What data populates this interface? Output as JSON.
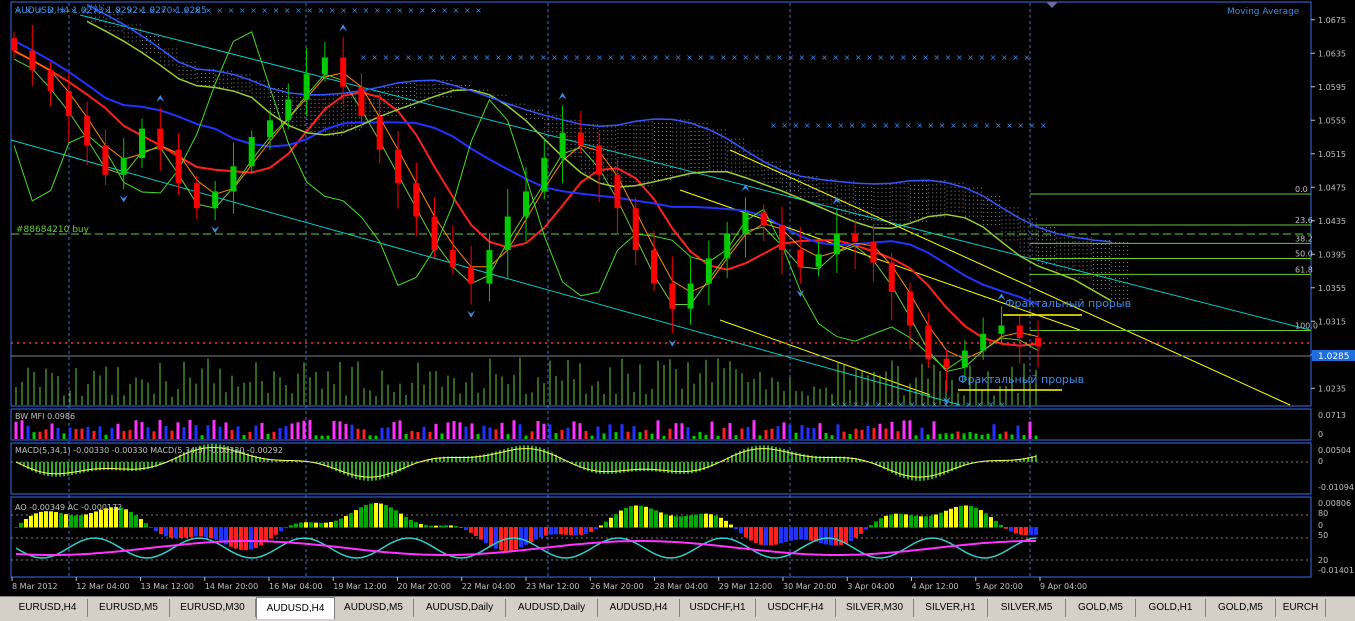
{
  "colors": {
    "background": "#000000",
    "frame": "#3a6ee8",
    "axis_text": "#c0c0c0",
    "bull_candle": "#00cc00",
    "bear_candle": "#ff0000",
    "price_label_bg": "#1e6ee0",
    "title_text": "#3a8ce8",
    "fractal_arrow": "#3a8ce8",
    "ichimoku_cloud_dots": "#ffffff",
    "channel": "#00cccc",
    "yellow_lines": "#ffff00",
    "fibo": "#66cc33",
    "macd_signal": "#ffff66",
    "ao_magenta": "#ff33ff",
    "ac_cyan": "#33cccc"
  },
  "main_chart": {
    "title": "AUDUSD,H4  1.0273 1.0292 1.0270 1.0285",
    "indicator_name": "Moving Average",
    "order_label": "#88684210 buy",
    "current_price": "1.0285",
    "annotations": [
      "Фрактальный прорыв",
      "Фрактальный прорыв"
    ],
    "price_ticks": [
      "1.0675",
      "1.0635",
      "1.0595",
      "1.0555",
      "1.0515",
      "1.0475",
      "1.0435",
      "1.0395",
      "1.0355",
      "1.0315",
      "1.0275",
      "1.0235"
    ],
    "price_range": [
      1.0215,
      1.0695
    ],
    "fibo_levels": [
      {
        "label": "0.0",
        "price": 1.0467
      },
      {
        "label": "23.6",
        "price": 1.043
      },
      {
        "label": "38.2",
        "price": 1.0408
      },
      {
        "label": "50.0",
        "price": 1.039
      },
      {
        "label": "61.8",
        "price": 1.0371
      },
      {
        "label": "100.0",
        "price": 1.0304
      }
    ],
    "closes": [
      1.0638,
      1.0615,
      1.059,
      1.056,
      1.0525,
      1.049,
      1.051,
      1.0545,
      1.052,
      1.048,
      1.045,
      1.047,
      1.05,
      1.0535,
      1.0555,
      1.058,
      1.061,
      1.063,
      1.0595,
      1.056,
      1.052,
      1.048,
      1.044,
      1.04,
      1.038,
      1.036,
      1.04,
      1.044,
      1.047,
      1.051,
      1.054,
      1.0525,
      1.049,
      1.045,
      1.04,
      1.036,
      1.033,
      1.036,
      1.039,
      1.042,
      1.0445,
      1.043,
      1.04,
      1.038,
      1.0395,
      1.042,
      1.041,
      1.0385,
      1.035,
      1.031,
      1.027,
      1.026,
      1.028,
      1.03,
      1.031,
      1.0295,
      1.0285
    ]
  },
  "mfi": {
    "label": "BW MFI 0.0986",
    "ticks": [
      "0.0713",
      "0"
    ]
  },
  "macd": {
    "label": "MACD(5,34,1) -0.00330 -0.00330  MACD(5,34,5) -0.00330 -0.00292",
    "ticks": [
      "0.00504",
      "0",
      "-0.01094"
    ]
  },
  "ao_ac": {
    "label": "AO -0.00349  AC -0.000172",
    "ticks": [
      "0.00806",
      "80",
      "0",
      "50",
      "20",
      "-0.01401"
    ]
  },
  "time_axis": [
    "8 Mar 2012",
    "12 Mar 04:00",
    "13 Mar 12:00",
    "14 Mar 20:00",
    "16 Mar 04:00",
    "19 Mar 12:00",
    "20 Mar 20:00",
    "22 Mar 04:00",
    "23 Mar 12:00",
    "26 Mar 20:00",
    "28 Mar 04:00",
    "29 Mar 12:00",
    "30 Mar 20:00",
    "3 Apr 04:00",
    "4 Apr 12:00",
    "5 Apr 20:00",
    "9 Apr 04:00"
  ],
  "tabs": [
    "EURUSD,H4",
    "EURUSD,M5",
    "EURUSD,M30",
    "AUDUSD,H4",
    "AUDUSD,M5",
    "AUDUSD,Daily",
    "AUDUSD,Daily",
    "AUDUSD,H4",
    "USDCHF,H1",
    "USDCHF,H4",
    "SILVER,M30",
    "SILVER,H1",
    "SILVER,M5",
    "GOLD,M5",
    "GOLD,H1",
    "GOLD,M5",
    "EURCH"
  ],
  "active_tab": 3
}
